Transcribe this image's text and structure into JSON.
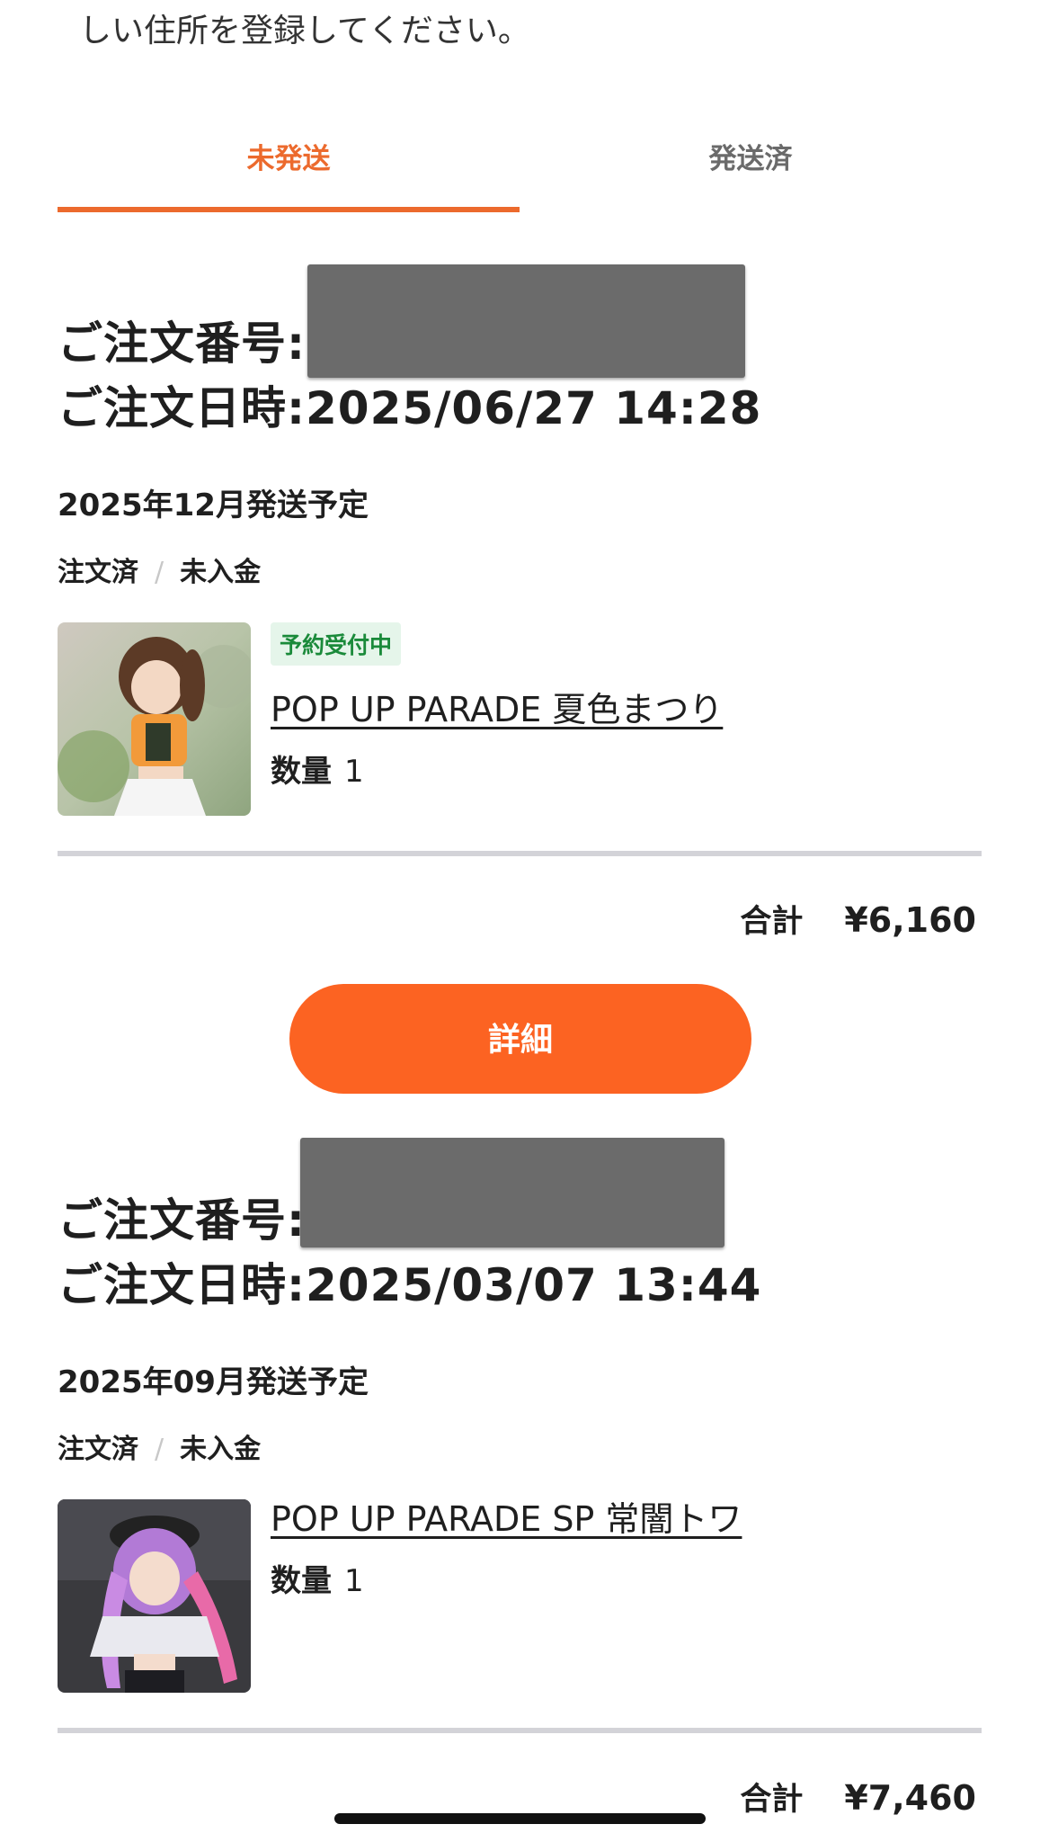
{
  "notice": {
    "line2": "しい住所を登録してください。"
  },
  "tabs": [
    {
      "label": "未発送",
      "active": true
    },
    {
      "label": "発送済",
      "active": false
    }
  ],
  "colors": {
    "accent": "#ec6a2d",
    "button": "#fc6322",
    "badge_bg": "#e5f5ea",
    "badge_text": "#1a8a3a"
  },
  "orders": [
    {
      "number_label": "ご注文番号:",
      "date_label": "ご注文日時:",
      "date_value": "2025/06/27 14:28",
      "ship_schedule": "2025年12月発送予定",
      "status_order": "注文済",
      "status_payment": "未入金",
      "badge": "予約受付中",
      "product": "POP UP PARADE 夏色まつり",
      "qty_label": "数量",
      "qty_value": "1",
      "total_label": "合計",
      "total_value": "¥6,160",
      "detail_label": "詳細"
    },
    {
      "number_label": "ご注文番号:",
      "date_label": "ご注文日時:",
      "date_value": "2025/03/07 13:44",
      "ship_schedule": "2025年09月発送予定",
      "status_order": "注文済",
      "status_payment": "未入金",
      "product": "POP UP PARADE SP 常闇トワ",
      "qty_label": "数量",
      "qty_value": "1",
      "total_label": "合計",
      "total_value": "¥7,460"
    }
  ]
}
